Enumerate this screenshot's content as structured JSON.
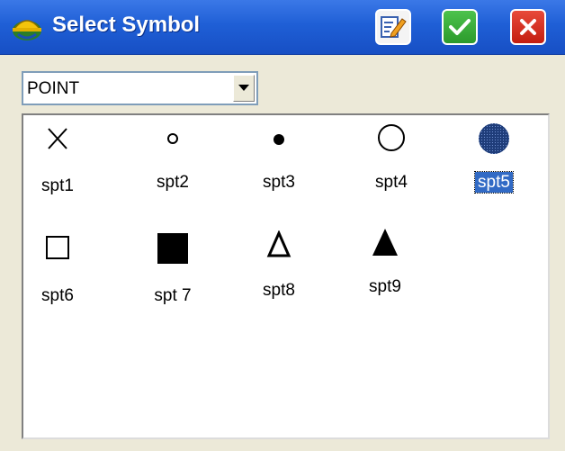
{
  "window": {
    "title": "Select Symbol"
  },
  "toolbar": {
    "edit_icon": "edit-icon",
    "ok_icon": "checkmark-icon",
    "cancel_icon": "close-icon"
  },
  "dropdown": {
    "selected": "POINT"
  },
  "symbols": [
    {
      "label": "spt1",
      "shape": "x-mark"
    },
    {
      "label": "spt2",
      "shape": "small-circle-outline"
    },
    {
      "label": "spt3",
      "shape": "small-filled-circle"
    },
    {
      "label": "spt4",
      "shape": "large-circle-outline"
    },
    {
      "label": "spt5",
      "shape": "large-filled-circle",
      "selected": true
    },
    {
      "label": "spt6",
      "shape": "square-outline"
    },
    {
      "label": "spt 7",
      "shape": "filled-square"
    },
    {
      "label": "spt8",
      "shape": "triangle-outline"
    },
    {
      "label": "spt9",
      "shape": "filled-triangle"
    }
  ],
  "colors": {
    "titlebar": "#1f5fd6",
    "selection": "#316ac5",
    "ok_button": "#2c9a2c",
    "cancel_button": "#c41e10"
  }
}
